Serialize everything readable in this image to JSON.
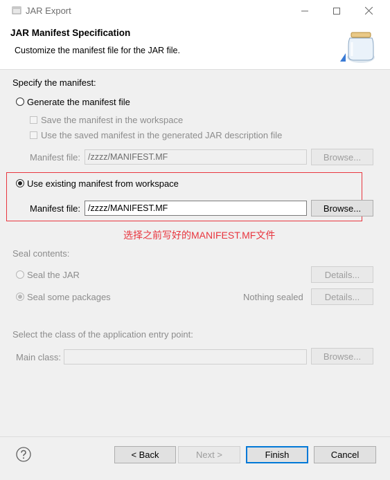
{
  "window": {
    "title": "JAR Export",
    "buttons": [
      "minimize",
      "maximize",
      "close"
    ]
  },
  "header": {
    "title": "JAR Manifest Specification",
    "description": "Customize the manifest file for the JAR file.",
    "icon": "jar-icon"
  },
  "manifest": {
    "section_label": "Specify the manifest:",
    "generate": {
      "label": "Generate the manifest file",
      "selected": false,
      "save_in_workspace": "Save the manifest in the workspace",
      "use_saved": "Use the saved manifest in the generated JAR description file",
      "file_label": "Manifest file:",
      "file_value": "/zzzz/MANIFEST.MF",
      "browse": "Browse..."
    },
    "existing": {
      "label": "Use existing manifest from workspace",
      "selected": true,
      "file_label": "Manifest file:",
      "file_value": "/zzzz/MANIFEST.MF",
      "browse": "Browse..."
    },
    "annotation": "选择之前写好的MANIFEST.MF文件"
  },
  "seal": {
    "section_label": "Seal contents:",
    "seal_jar": "Seal the JAR",
    "seal_some": "Seal some packages",
    "status": "Nothing sealed",
    "details1": "Details...",
    "details2": "Details..."
  },
  "entry": {
    "section_label": "Select the class of the application entry point:",
    "main_class_label": "Main class:",
    "main_class_value": "",
    "browse": "Browse..."
  },
  "footer": {
    "back": "< Back",
    "next": "Next >",
    "finish": "Finish",
    "cancel": "Cancel"
  },
  "colors": {
    "annotation_red": "#e8353e",
    "default_button_border": "#0078d7"
  }
}
